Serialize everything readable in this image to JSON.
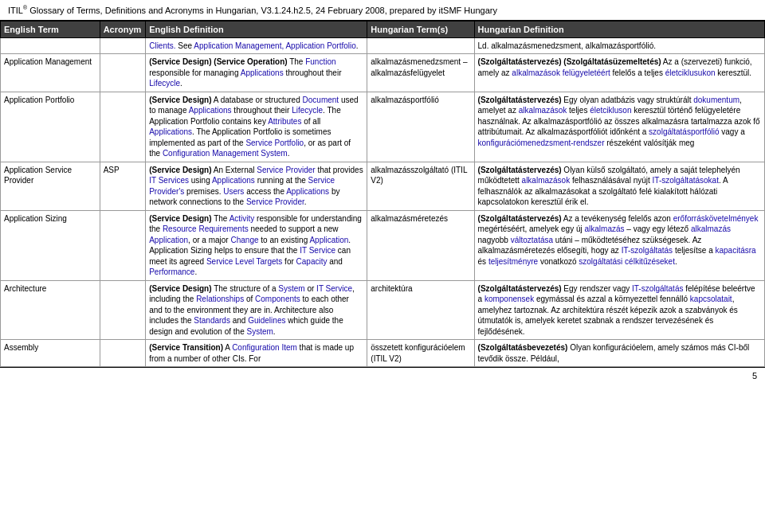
{
  "header": {
    "text": "ITIL",
    "sup": "®",
    "rest": " Glossary of Terms, Definitions and Acronyms in Hungarian, V3.1.24.h2.5, 24 February 2008, prepared by itSMF Hungary"
  },
  "table": {
    "columns": [
      {
        "label": "English Term"
      },
      {
        "label": "Acronym"
      },
      {
        "label": "English Definition"
      },
      {
        "label": "Hungarian Term(s)"
      },
      {
        "label": "Hungarian Definition"
      }
    ],
    "rows": [
      {
        "term": "",
        "acronym": "",
        "endef_parts": [
          {
            "text": "Clients.",
            "type": "blue"
          },
          {
            "text": " See ",
            "type": "plain"
          },
          {
            "text": "Application Management, Application Portfolio",
            "type": "blue"
          },
          {
            "text": ".",
            "type": "plain"
          }
        ],
        "hunterm": "",
        "hundef_parts": [
          {
            "text": "Ld. alkalmazásmenedzsment, alkalmazásportfólió.",
            "type": "plain"
          }
        ]
      },
      {
        "term": "Application Management",
        "acronym": "",
        "endef_parts": [
          {
            "text": "(Service Design) (Service Operation)",
            "type": "bold"
          },
          {
            "text": " The ",
            "type": "plain"
          },
          {
            "text": "Function",
            "type": "blue"
          },
          {
            "text": " responsible for managing ",
            "type": "plain"
          },
          {
            "text": "Applications",
            "type": "blue"
          },
          {
            "text": " throughout their ",
            "type": "plain"
          },
          {
            "text": "Lifecycle",
            "type": "blue"
          },
          {
            "text": ".",
            "type": "plain"
          }
        ],
        "hunterm": "alkalmazásmenedzsment – alkalmazásfelügyelet",
        "hundef_parts": [
          {
            "text": "(Szolgáltatástervezés) (Szolgáltatásüzemeltetés)",
            "type": "bold"
          },
          {
            "text": " Az a (szervezeti) funkció, amely az ",
            "type": "plain"
          },
          {
            "text": "alkalmazások felügyeletéért",
            "type": "blue"
          },
          {
            "text": " felelős a teljes ",
            "type": "plain"
          },
          {
            "text": "életciklusukon",
            "type": "blue"
          },
          {
            "text": " keresztül.",
            "type": "plain"
          }
        ]
      },
      {
        "term": "Application Portfolio",
        "acronym": "",
        "endef_parts": [
          {
            "text": "(Service Design)",
            "type": "bold"
          },
          {
            "text": " A database or structured ",
            "type": "plain"
          },
          {
            "text": "Document",
            "type": "blue"
          },
          {
            "text": " used to manage ",
            "type": "plain"
          },
          {
            "text": "Applications",
            "type": "blue"
          },
          {
            "text": " throughout their ",
            "type": "plain"
          },
          {
            "text": "Lifecycle",
            "type": "blue"
          },
          {
            "text": ". The Application Portfolio contains key ",
            "type": "plain"
          },
          {
            "text": "Attributes",
            "type": "blue"
          },
          {
            "text": " of all ",
            "type": "plain"
          },
          {
            "text": "Applications",
            "type": "blue"
          },
          {
            "text": ". The Application Portfolio is sometimes implemented as part of the ",
            "type": "plain"
          },
          {
            "text": "Service Portfolio",
            "type": "blue"
          },
          {
            "text": ", or as part of the ",
            "type": "plain"
          },
          {
            "text": "Configuration Management System",
            "type": "blue"
          },
          {
            "text": ".",
            "type": "plain"
          }
        ],
        "hunterm": "alkalmazásportfólió",
        "hundef_parts": [
          {
            "text": "(Szolgáltatástervezés)",
            "type": "bold"
          },
          {
            "text": " Egy olyan adatbázis vagy struktúrált ",
            "type": "plain"
          },
          {
            "text": "dokumentum",
            "type": "blue"
          },
          {
            "text": ", amelyet az ",
            "type": "plain"
          },
          {
            "text": "alkalmazások",
            "type": "blue"
          },
          {
            "text": " teljes ",
            "type": "plain"
          },
          {
            "text": "életcikluson",
            "type": "blue"
          },
          {
            "text": " keresztül történő felügyeletére használnak. Az alkalmazásportfólió az összes alkalmazásra tartalmazza azok fő attribútumait. Az alkalmazásportfóliót időnként a ",
            "type": "plain"
          },
          {
            "text": "szolgáltatásportfólió",
            "type": "blue"
          },
          {
            "text": " vagy a ",
            "type": "plain"
          },
          {
            "text": "konfigurációmenedzsment-rendszer",
            "type": "blue"
          },
          {
            "text": " részeként valósítják meg",
            "type": "plain"
          }
        ]
      },
      {
        "term": "Application Service Provider",
        "acronym": "ASP",
        "endef_parts": [
          {
            "text": "(Service Design)",
            "type": "bold"
          },
          {
            "text": " An External ",
            "type": "plain"
          },
          {
            "text": "Service Provider",
            "type": "blue"
          },
          {
            "text": " that provides ",
            "type": "plain"
          },
          {
            "text": "IT Services",
            "type": "blue"
          },
          {
            "text": " using ",
            "type": "plain"
          },
          {
            "text": "Applications",
            "type": "blue"
          },
          {
            "text": " running at the ",
            "type": "plain"
          },
          {
            "text": "Service Provider's",
            "type": "blue"
          },
          {
            "text": " premises. ",
            "type": "plain"
          },
          {
            "text": "Users",
            "type": "blue"
          },
          {
            "text": " access the ",
            "type": "plain"
          },
          {
            "text": "Applications",
            "type": "blue"
          },
          {
            "text": " by network connections to the ",
            "type": "plain"
          },
          {
            "text": "Service Provider",
            "type": "blue"
          },
          {
            "text": ".",
            "type": "plain"
          }
        ],
        "hunterm": "alkalmazásszolgáltató (ITIL V2)",
        "hundef_parts": [
          {
            "text": "(Szolgáltatástervezés)",
            "type": "bold"
          },
          {
            "text": " Olyan külső szolgáltató, amely a saját telephelyén működtetett ",
            "type": "plain"
          },
          {
            "text": "alkalmazások",
            "type": "blue"
          },
          {
            "text": " felhasználásával nyújt ",
            "type": "plain"
          },
          {
            "text": "IT-szolgáltatásokat",
            "type": "blue"
          },
          {
            "text": ". A felhasználók az alkalmazásokat a szolgáltató felé kialakított hálózati kapcsolatokon keresztül érik el.",
            "type": "plain"
          }
        ]
      },
      {
        "term": "Application Sizing",
        "acronym": "",
        "endef_parts": [
          {
            "text": "(Service Design)",
            "type": "bold"
          },
          {
            "text": " The ",
            "type": "plain"
          },
          {
            "text": "Activity",
            "type": "blue"
          },
          {
            "text": " responsible for understanding the ",
            "type": "plain"
          },
          {
            "text": "Resource Requirements",
            "type": "blue"
          },
          {
            "text": " needed to support a new ",
            "type": "plain"
          },
          {
            "text": "Application",
            "type": "blue"
          },
          {
            "text": ", or a major ",
            "type": "plain"
          },
          {
            "text": "Change",
            "type": "blue"
          },
          {
            "text": " to an existing ",
            "type": "plain"
          },
          {
            "text": "Application",
            "type": "blue"
          },
          {
            "text": ". Application Sizing helps to ensure that the ",
            "type": "plain"
          },
          {
            "text": "IT Service",
            "type": "blue"
          },
          {
            "text": " can meet its agreed ",
            "type": "plain"
          },
          {
            "text": "Service Level Targets",
            "type": "blue"
          },
          {
            "text": " for ",
            "type": "plain"
          },
          {
            "text": "Capacity",
            "type": "blue"
          },
          {
            "text": " and ",
            "type": "plain"
          },
          {
            "text": "Performance",
            "type": "blue"
          },
          {
            "text": ".",
            "type": "plain"
          }
        ],
        "hunterm": "alkalmazásméretezés",
        "hundef_parts": [
          {
            "text": "(Szolgáltatástervezés)",
            "type": "bold"
          },
          {
            "text": " Az a tevékenység felelős azon ",
            "type": "plain"
          },
          {
            "text": "erőforráskövetelmények",
            "type": "blue"
          },
          {
            "text": " megértéséért, amelyek egy új ",
            "type": "plain"
          },
          {
            "text": "alkalmazás",
            "type": "blue"
          },
          {
            "text": " – vagy egy létező ",
            "type": "plain"
          },
          {
            "text": "alkalmazás",
            "type": "blue"
          },
          {
            "text": " nagyobb ",
            "type": "plain"
          },
          {
            "text": "változtatása",
            "type": "blue"
          },
          {
            "text": " utáni – működtetéséhez szükségesek. Az alkalmazásméretezés elősegíti, hogy az ",
            "type": "plain"
          },
          {
            "text": "IT-szolgáltatás",
            "type": "blue"
          },
          {
            "text": " teljesítse a ",
            "type": "plain"
          },
          {
            "text": "kapacitásra",
            "type": "blue"
          },
          {
            "text": " és ",
            "type": "plain"
          },
          {
            "text": "teljesítményre",
            "type": "blue"
          },
          {
            "text": " vonatkozó ",
            "type": "plain"
          },
          {
            "text": "szolgáltatási célkitűzéseket",
            "type": "blue"
          },
          {
            "text": ".",
            "type": "plain"
          }
        ]
      },
      {
        "term": "Architecture",
        "acronym": "",
        "endef_parts": [
          {
            "text": "(Service Design)",
            "type": "bold"
          },
          {
            "text": " The structure of a ",
            "type": "plain"
          },
          {
            "text": "System",
            "type": "blue"
          },
          {
            "text": " or ",
            "type": "plain"
          },
          {
            "text": "IT Service",
            "type": "blue"
          },
          {
            "text": ", including the ",
            "type": "plain"
          },
          {
            "text": "Relationships",
            "type": "blue"
          },
          {
            "text": " of ",
            "type": "plain"
          },
          {
            "text": "Components",
            "type": "blue"
          },
          {
            "text": " to each other and to the environment they are in. Architecture also includes the ",
            "type": "plain"
          },
          {
            "text": "Standards",
            "type": "blue"
          },
          {
            "text": " and ",
            "type": "plain"
          },
          {
            "text": "Guidelines",
            "type": "blue"
          },
          {
            "text": " which guide the design and evolution of the ",
            "type": "plain"
          },
          {
            "text": "System",
            "type": "blue"
          },
          {
            "text": ".",
            "type": "plain"
          }
        ],
        "hunterm": "architektúra",
        "hundef_parts": [
          {
            "text": "(Szolgáltatástervezés)",
            "type": "bold"
          },
          {
            "text": " Egy rendszer vagy ",
            "type": "plain"
          },
          {
            "text": "IT-szolgáltatás",
            "type": "blue"
          },
          {
            "text": " felépítése beleértve a ",
            "type": "plain"
          },
          {
            "text": "komponensek",
            "type": "blue"
          },
          {
            "text": " egymással és azzal a környezettel fennálló ",
            "type": "plain"
          },
          {
            "text": "kapcsolatait",
            "type": "blue"
          },
          {
            "text": ", amelyhez tartoznak. Az architektúra részét képezik azok a szabványok és útmutatók is, amelyek keretet szabnak a rendszer tervezésének és fejlődésének.",
            "type": "plain"
          }
        ]
      },
      {
        "term": "Assembly",
        "acronym": "",
        "endef_parts": [
          {
            "text": "(Service Transition)",
            "type": "bold"
          },
          {
            "text": " A ",
            "type": "plain"
          },
          {
            "text": "Configuration Item",
            "type": "blue"
          },
          {
            "text": " that is made up from a number of other CIs. For",
            "type": "plain"
          }
        ],
        "hunterm": "összetett konfigurációelem (ITIL V2)",
        "hundef_parts": [
          {
            "text": "(Szolgáltatásbevezetés)",
            "type": "bold"
          },
          {
            "text": " Olyan konfigurációelem, amely számos más CI-ből tevődik össze. Például,",
            "type": "plain"
          }
        ]
      }
    ]
  },
  "footer": {
    "page_number": "5"
  }
}
